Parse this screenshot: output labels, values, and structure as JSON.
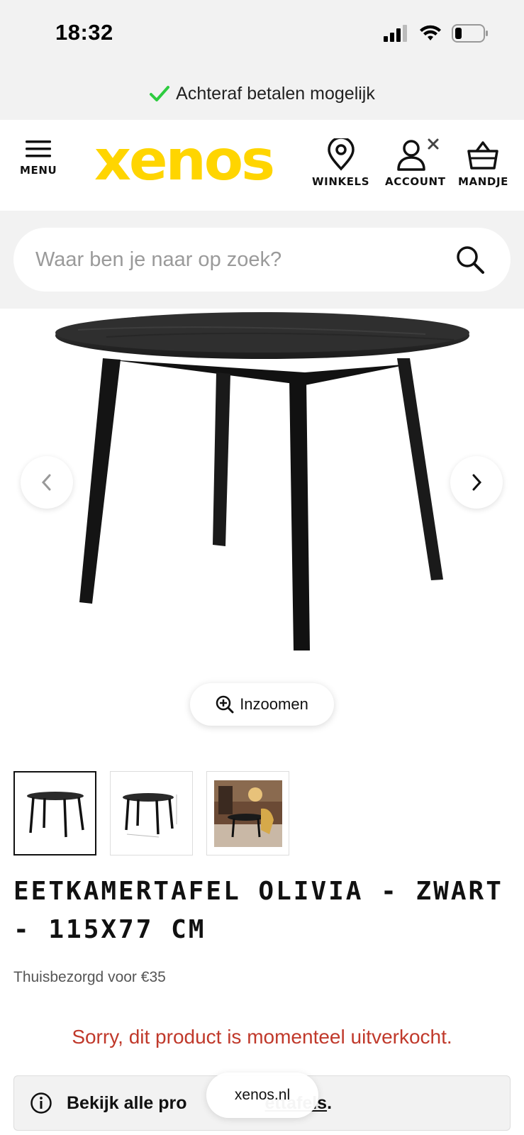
{
  "status_bar": {
    "time": "18:32"
  },
  "promo": {
    "text": "Achteraf betalen mogelijk"
  },
  "header": {
    "menu_label": "MENU",
    "logo_text": "xenos",
    "stores_label": "WINKELS",
    "account_label": "ACCOUNT",
    "cart_label": "MANDJE"
  },
  "search": {
    "placeholder": "Waar ben je naar op zoek?"
  },
  "gallery": {
    "zoom_label": "Inzoomen"
  },
  "product": {
    "title": "EETKAMERTAFEL OLIVIA - ZWART - 115X77 CM",
    "delivery": "Thuisbezorgd voor €35",
    "soldout_message": "Sorry, dit product is momenteel uitverkocht.",
    "info_prefix": "Bekijk alle pro",
    "info_link": "ettafels",
    "info_suffix": "."
  },
  "browser": {
    "url": "xenos.nl"
  },
  "colors": {
    "brand_yellow": "#FFD500",
    "check_green": "#2ecc40",
    "soldout_red": "#c0392b"
  }
}
